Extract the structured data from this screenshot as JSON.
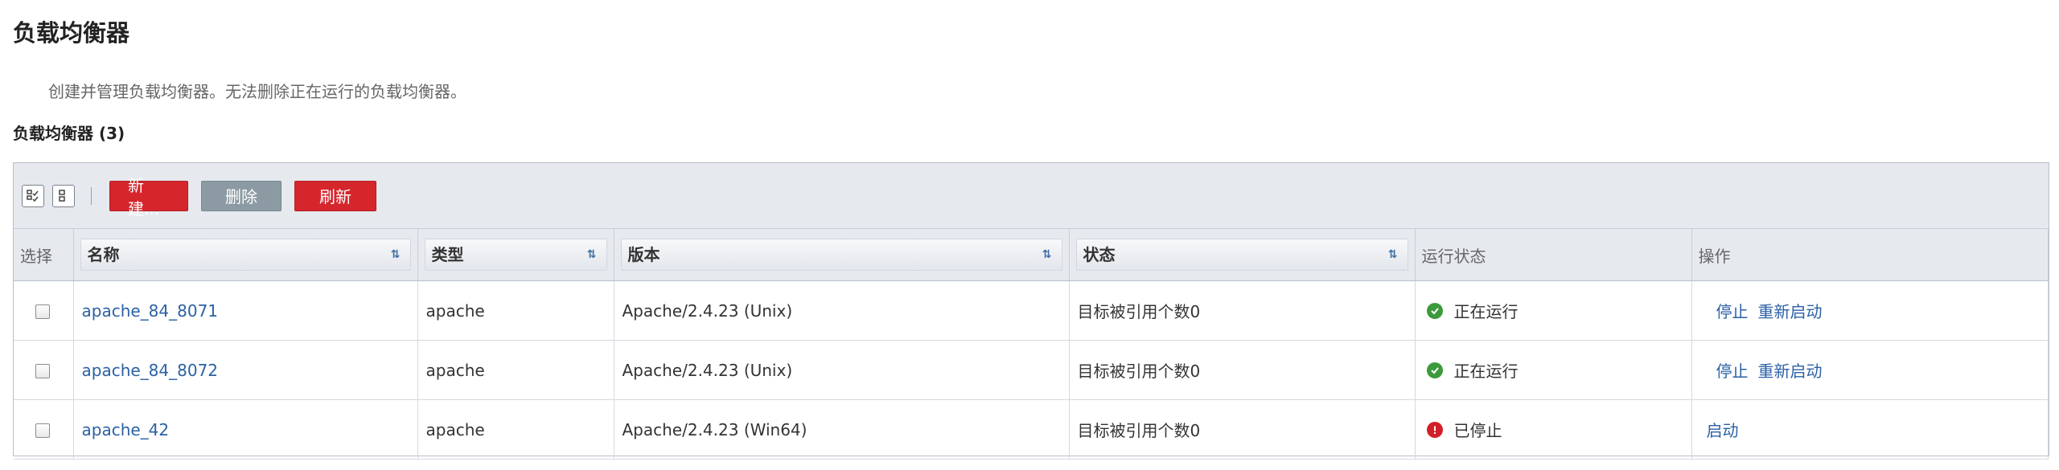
{
  "page": {
    "title": "负载均衡器",
    "description": "创建并管理负载均衡器。无法删除正在运行的负载均衡器。",
    "section_title": "负载均衡器 (3)"
  },
  "toolbar": {
    "new_label": "新建...",
    "delete_label": "删除",
    "refresh_label": "刷新"
  },
  "colors": {
    "accent_red": "#d5262c",
    "disabled_gray": "#8c9aa3",
    "link_blue": "#2b61a5",
    "running_green": "#3c9a3c",
    "stopped_red": "#d1202a"
  },
  "table": {
    "columns": [
      "选择",
      "名称",
      "类型",
      "版本",
      "状态",
      "运行状态",
      "操作"
    ],
    "rows": [
      {
        "name": "apache_84_8071",
        "type": "apache",
        "version": "Apache/2.4.23 (Unix)",
        "state": "目标被引用个数0",
        "run_state": "正在运行",
        "run_icon": "check-circle-icon",
        "actions": [
          "停止",
          "重新启动"
        ]
      },
      {
        "name": "apache_84_8072",
        "type": "apache",
        "version": "Apache/2.4.23 (Unix)",
        "state": "目标被引用个数0",
        "run_state": "正在运行",
        "run_icon": "check-circle-icon",
        "actions": [
          "停止",
          "重新启动"
        ]
      },
      {
        "name": "apache_42",
        "type": "apache",
        "version": "Apache/2.4.23 (Win64)",
        "state": "目标被引用个数0",
        "run_state": "已停止",
        "run_icon": "exclamation-circle-icon",
        "actions": [
          "启动"
        ]
      }
    ]
  }
}
